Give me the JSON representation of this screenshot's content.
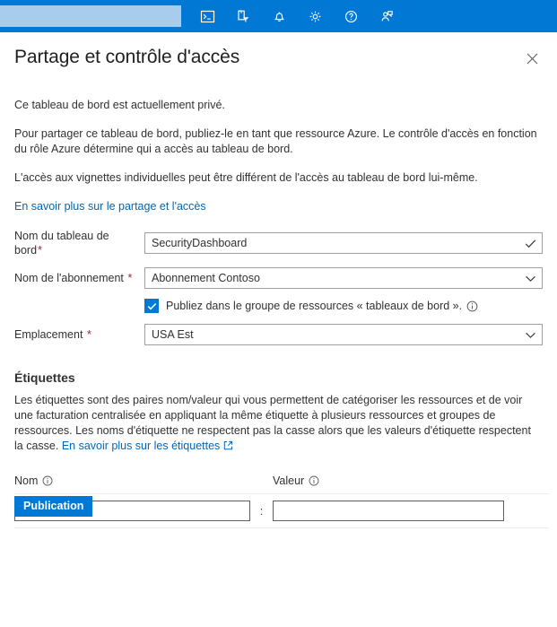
{
  "portal_header": {
    "search_placeholder": "",
    "search_value": "",
    "icons": [
      {
        "name": "cloud-shell-icon",
        "label": "Cloud Shell"
      },
      {
        "name": "directories-subscriptions-icon",
        "label": "Répertoires + abonnements"
      },
      {
        "name": "notifications-bell-icon",
        "label": "Notifications"
      },
      {
        "name": "settings-gear-icon",
        "label": "Paramètres"
      },
      {
        "name": "help-question-icon",
        "label": "Aide"
      },
      {
        "name": "feedback-person-icon",
        "label": "Commentaires"
      }
    ]
  },
  "blade": {
    "title": "Partage et contrôle d'accès",
    "close_label": "Fermer"
  },
  "intro": {
    "paragraph_1": "Ce tableau de bord est actuellement privé.",
    "paragraph_2": "Pour partager ce tableau de bord, publiez-le en tant que ressource Azure. Le contrôle d'accès en fonction du rôle Azure détermine qui a accès au tableau de bord.",
    "paragraph_3": "L'accès aux vignettes individuelles peut être différent de l'accès au tableau de bord lui-même.",
    "learn_more_link": "En savoir plus sur le partage et l'accès"
  },
  "form": {
    "dashboard_name": {
      "label": "Nom du tableau de bord",
      "required_mark": "*",
      "value": "SecurityDashboard",
      "placeholder": "",
      "icon": "checkmark-icon"
    },
    "subscription_name": {
      "label": "Nom de l'abonnement",
      "required_mark": "*",
      "value": "Abonnement Contoso",
      "icon": "chevron-down-icon"
    },
    "publish_checkbox": {
      "checked": true,
      "label": "Publiez dans le groupe de ressources « tableaux de bord ».",
      "info_icon": "info-icon"
    },
    "location": {
      "label": "Emplacement",
      "required_mark": "*",
      "value": "USA Est",
      "icon": "chevron-down-icon"
    }
  },
  "tags": {
    "section_title": "Étiquettes",
    "description": "Les étiquettes sont des paires nom/valeur qui vous permettent de catégoriser les ressources et de voir une facturation centralisée en appliquant la même étiquette à plusieurs ressources et groupes de ressources. Les noms d'étiquette ne respectent pas la casse alors que les valeurs d'étiquette respectent la casse.",
    "learn_more_link": "En savoir plus sur les étiquettes",
    "column_name": "Nom",
    "column_value": "Valeur",
    "separator": ":",
    "rows": [
      {
        "name": "",
        "value": "",
        "name_placeholder": "",
        "value_placeholder": ""
      }
    ]
  },
  "footer": {
    "publish_button": "Publication"
  },
  "colors": {
    "azure_blue": "#0078d4",
    "link_blue": "#0067b8",
    "required_red": "#a4262c",
    "search_box": "#a8cdec",
    "border_gray": "#a19f9d"
  }
}
